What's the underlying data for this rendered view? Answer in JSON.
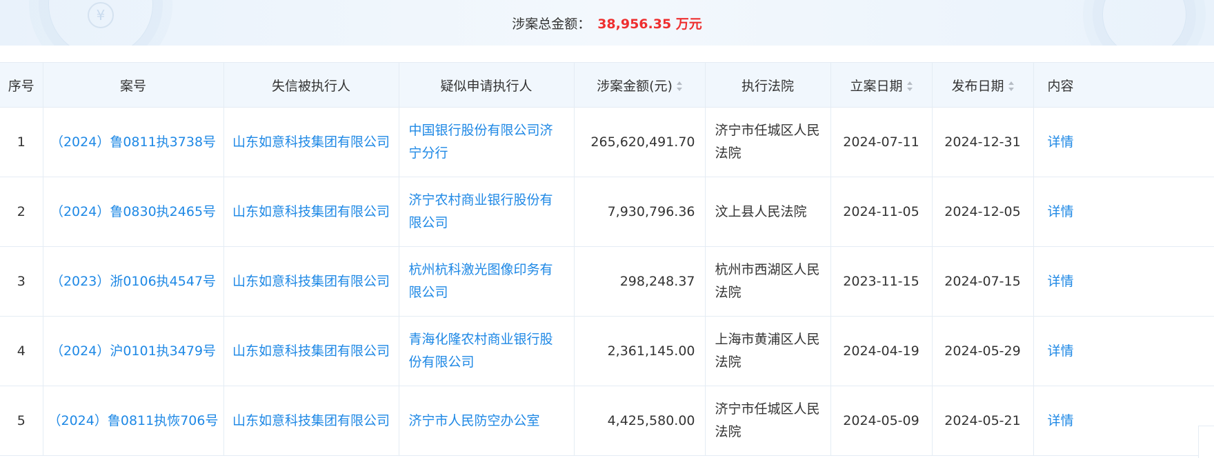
{
  "summary": {
    "label": "涉案总金额：",
    "value": "38,956.35 万元"
  },
  "table": {
    "headers": {
      "index": "序号",
      "case_no": "案号",
      "debtor": "失信被执行人",
      "applicant": "疑似申请执行人",
      "amount": "涉案金额(元)",
      "court": "执行法院",
      "filing_date": "立案日期",
      "publish_date": "发布日期",
      "content": "内容"
    },
    "rows": [
      {
        "index": "1",
        "case_no": "（2024）鲁0811执3738号",
        "debtor": "山东如意科技集团有限公司",
        "applicant": "中国银行股份有限公司济宁分行",
        "amount": "265,620,491.70",
        "court": "济宁市任城区人民法院",
        "filing_date": "2024-07-11",
        "publish_date": "2024-12-31",
        "content": "详情"
      },
      {
        "index": "2",
        "case_no": "（2024）鲁0830执2465号",
        "debtor": "山东如意科技集团有限公司",
        "applicant": "济宁农村商业银行股份有限公司",
        "amount": "7,930,796.36",
        "court": "汶上县人民法院",
        "filing_date": "2024-11-05",
        "publish_date": "2024-12-05",
        "content": "详情"
      },
      {
        "index": "3",
        "case_no": "（2023）浙0106执4547号",
        "debtor": "山东如意科技集团有限公司",
        "applicant": "杭州杭科激光图像印务有限公司",
        "amount": "298,248.37",
        "court": "杭州市西湖区人民法院",
        "filing_date": "2023-11-15",
        "publish_date": "2024-07-15",
        "content": "详情"
      },
      {
        "index": "4",
        "case_no": "（2024）沪0101执3479号",
        "debtor": "山东如意科技集团有限公司",
        "applicant": "青海化隆农村商业银行股份有限公司",
        "amount": "2,361,145.00",
        "court": "上海市黄浦区人民法院",
        "filing_date": "2024-04-19",
        "publish_date": "2024-05-29",
        "content": "详情"
      },
      {
        "index": "5",
        "case_no": "（2024）鲁0811执恢706号",
        "debtor": "山东如意科技集团有限公司",
        "applicant": "济宁市人民防空办公室",
        "amount": "4,425,580.00",
        "court": "济宁市任城区人民法院",
        "filing_date": "2024-05-09",
        "publish_date": "2024-05-21",
        "content": "详情"
      }
    ]
  }
}
